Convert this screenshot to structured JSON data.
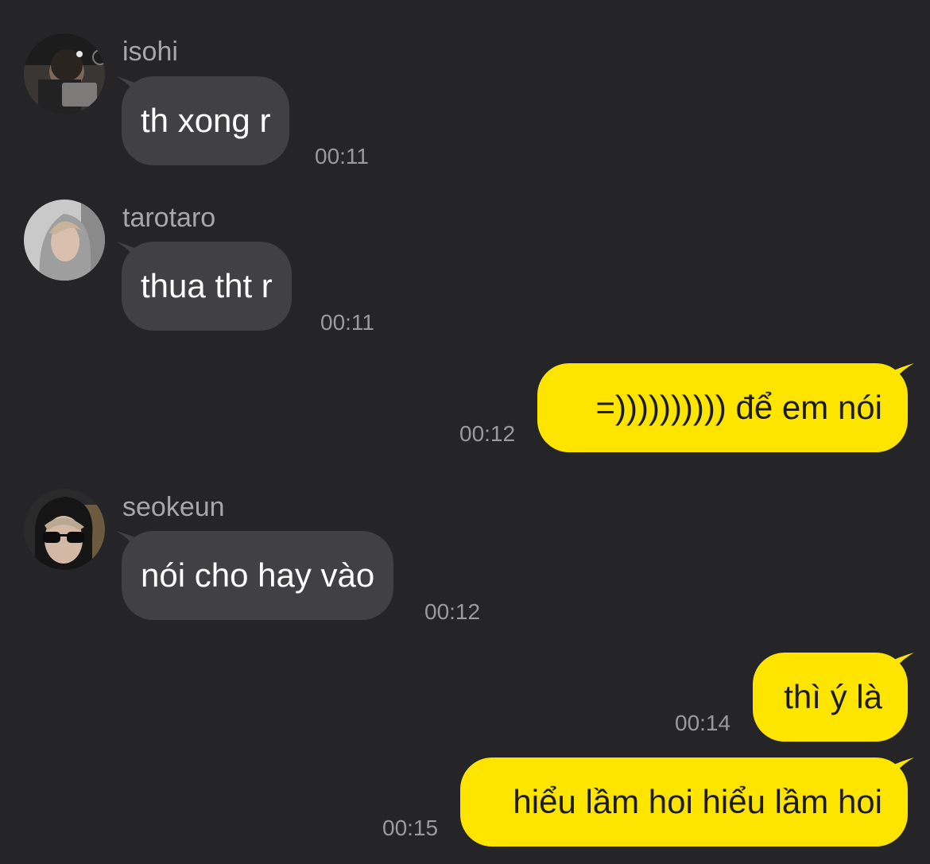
{
  "colors": {
    "background": "#252527",
    "incoming_bubble": "#414144",
    "outgoing_bubble": "#fee500",
    "sender_name": "#a7a7aa",
    "timestamp": "#9a9a9d"
  },
  "messages": [
    {
      "direction": "incoming",
      "sender": "isohi",
      "text": "th xong r",
      "time": "00:11",
      "avatar": "avatar-photo"
    },
    {
      "direction": "incoming",
      "sender": "tarotaro",
      "text": "thua tht r",
      "time": "00:11",
      "avatar": "avatar-photo"
    },
    {
      "direction": "outgoing",
      "text": "=)))))))))) để em nói",
      "time": "00:12"
    },
    {
      "direction": "incoming",
      "sender": "seokeun",
      "text": "nói cho hay vào",
      "time": "00:12",
      "avatar": "avatar-photo"
    },
    {
      "direction": "outgoing",
      "text": "thì ý là",
      "time": "00:14"
    },
    {
      "direction": "outgoing",
      "text": "hiểu lầm hoi hiểu lầm hoi",
      "time": "00:15"
    }
  ]
}
